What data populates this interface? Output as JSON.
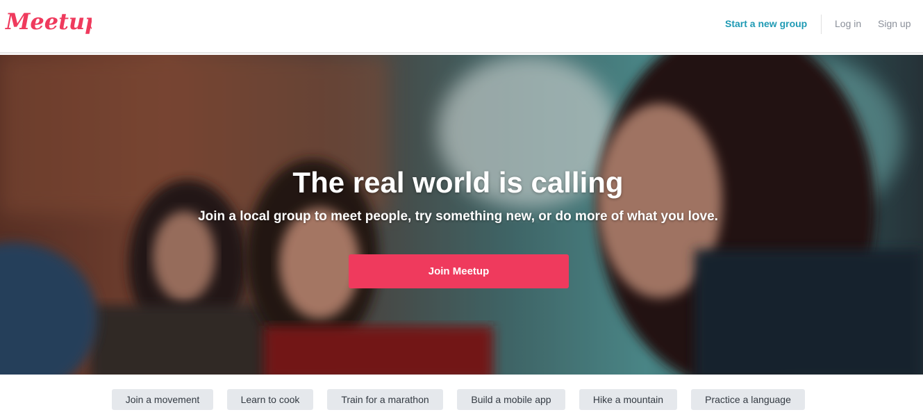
{
  "brand": {
    "logo_text": "Meetup",
    "logo_color": "#ef3a5d"
  },
  "nav": {
    "start_group": "Start a new group",
    "log_in": "Log in",
    "sign_up": "Sign up"
  },
  "hero": {
    "title": "The real world is calling",
    "subtitle": "Join a local group to meet people, try something new, or do more of what you love.",
    "cta": "Join Meetup",
    "cta_color": "#ef3a5d"
  },
  "topics": [
    "Join a movement",
    "Learn to cook",
    "Train for a marathon",
    "Build a mobile app",
    "Hike a mountain",
    "Practice a language"
  ]
}
